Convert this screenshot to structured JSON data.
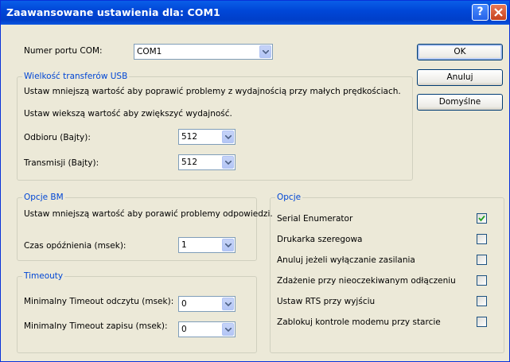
{
  "window": {
    "title": "Zaawansowane ustawienia dla: COM1"
  },
  "port": {
    "label": "Numer portu COM:",
    "value": "COM1"
  },
  "buttons": {
    "ok": "OK",
    "cancel": "Anuluj",
    "defaults": "Domyślne"
  },
  "usb": {
    "legend": "Wielkość transferów USB",
    "hint1": "Ustaw mniejszą wartość aby poprawić problemy z wydajnością przy małych prędkościach.",
    "hint2": "Ustaw wiekszą wartość aby zwiększyć wydajność.",
    "receive_label": "Odbioru (Bajty):",
    "receive_value": "512",
    "transmit_label": "Transmisji (Bajty):",
    "transmit_value": "512"
  },
  "bm": {
    "legend": "Opcje BM",
    "hint": "Ustaw mniejszą wartość aby porawić problemy odpowiedzi.",
    "latency_label": "Czas opóźnienia (msek):",
    "latency_value": "1"
  },
  "timeouts": {
    "legend": "Timeouty",
    "read_label": "Minimalny Timeout odczytu (msek):",
    "read_value": "0",
    "write_label": "Minimalny Timeout zapisu (msek):",
    "write_value": "0"
  },
  "options": {
    "legend": "Opcje",
    "items": [
      {
        "label": "Serial Enumerator",
        "checked": true
      },
      {
        "label": "Drukarka szeregowa",
        "checked": false
      },
      {
        "label": "Anuluj jeżeli wyłączanie zasilania",
        "checked": false
      },
      {
        "label": "Zdażenie przy nieoczekiwanym odłączeniu",
        "checked": false
      },
      {
        "label": "Ustaw RTS przy wyjściu",
        "checked": false
      },
      {
        "label": "Zablokuj kontrole modemu przy starcie",
        "checked": false
      }
    ]
  }
}
